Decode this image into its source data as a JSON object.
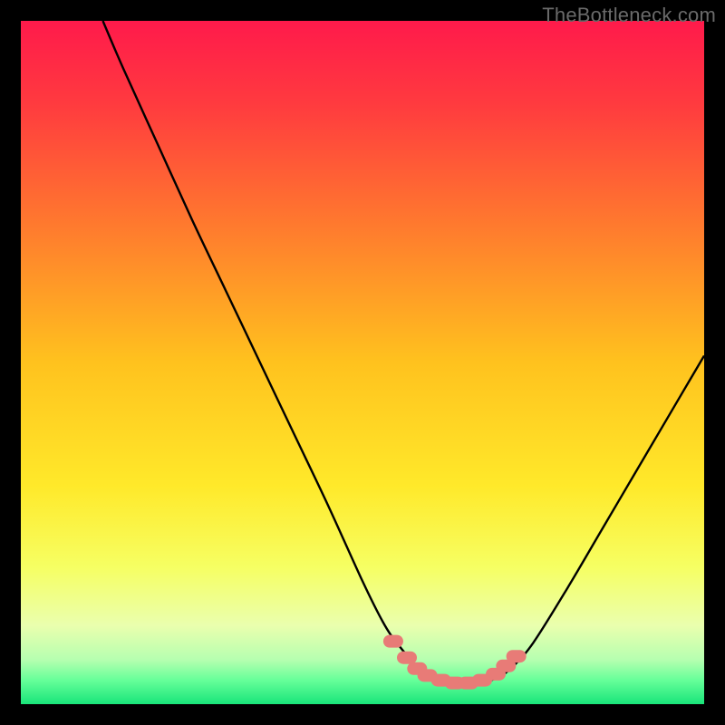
{
  "watermark": "TheBottleneck.com",
  "colors": {
    "black": "#000000",
    "curve": "#000000",
    "marker_fill": "#e87b77",
    "marker_stroke": "#d96763"
  },
  "chart_data": {
    "type": "line",
    "title": "",
    "xlabel": "",
    "ylabel": "",
    "xlim": [
      0,
      100
    ],
    "ylim": [
      0,
      100
    ],
    "gradient_stops": [
      {
        "offset": 0,
        "color": "#ff1a4b"
      },
      {
        "offset": 0.12,
        "color": "#ff3a3f"
      },
      {
        "offset": 0.3,
        "color": "#ff7a2e"
      },
      {
        "offset": 0.5,
        "color": "#ffc21e"
      },
      {
        "offset": 0.68,
        "color": "#ffe92a"
      },
      {
        "offset": 0.8,
        "color": "#f6ff63"
      },
      {
        "offset": 0.885,
        "color": "#eaffae"
      },
      {
        "offset": 0.935,
        "color": "#b6ffb0"
      },
      {
        "offset": 0.965,
        "color": "#66ff99"
      },
      {
        "offset": 1.0,
        "color": "#19e57a"
      }
    ],
    "series": [
      {
        "name": "bottleneck-curve",
        "x": [
          12,
          15,
          20,
          25,
          30,
          35,
          40,
          45,
          50,
          53,
          55,
          58,
          60,
          63,
          65,
          68,
          70,
          72,
          75,
          80,
          85,
          90,
          95,
          100
        ],
        "y": [
          100,
          93,
          82,
          71,
          60.5,
          50,
          39.5,
          29,
          18,
          12,
          9,
          5.5,
          4,
          3.2,
          3,
          3.3,
          4,
          5.5,
          9,
          17,
          25.5,
          34,
          42.5,
          51
        ]
      }
    ],
    "markers": {
      "name": "highlight-dots",
      "x": [
        54.5,
        56.5,
        58,
        59.5,
        61.5,
        63.5,
        65.5,
        67.5,
        69.5,
        71,
        72.5
      ],
      "y": [
        9.2,
        6.8,
        5.2,
        4.2,
        3.5,
        3.1,
        3.1,
        3.5,
        4.4,
        5.6,
        7.0
      ]
    }
  }
}
